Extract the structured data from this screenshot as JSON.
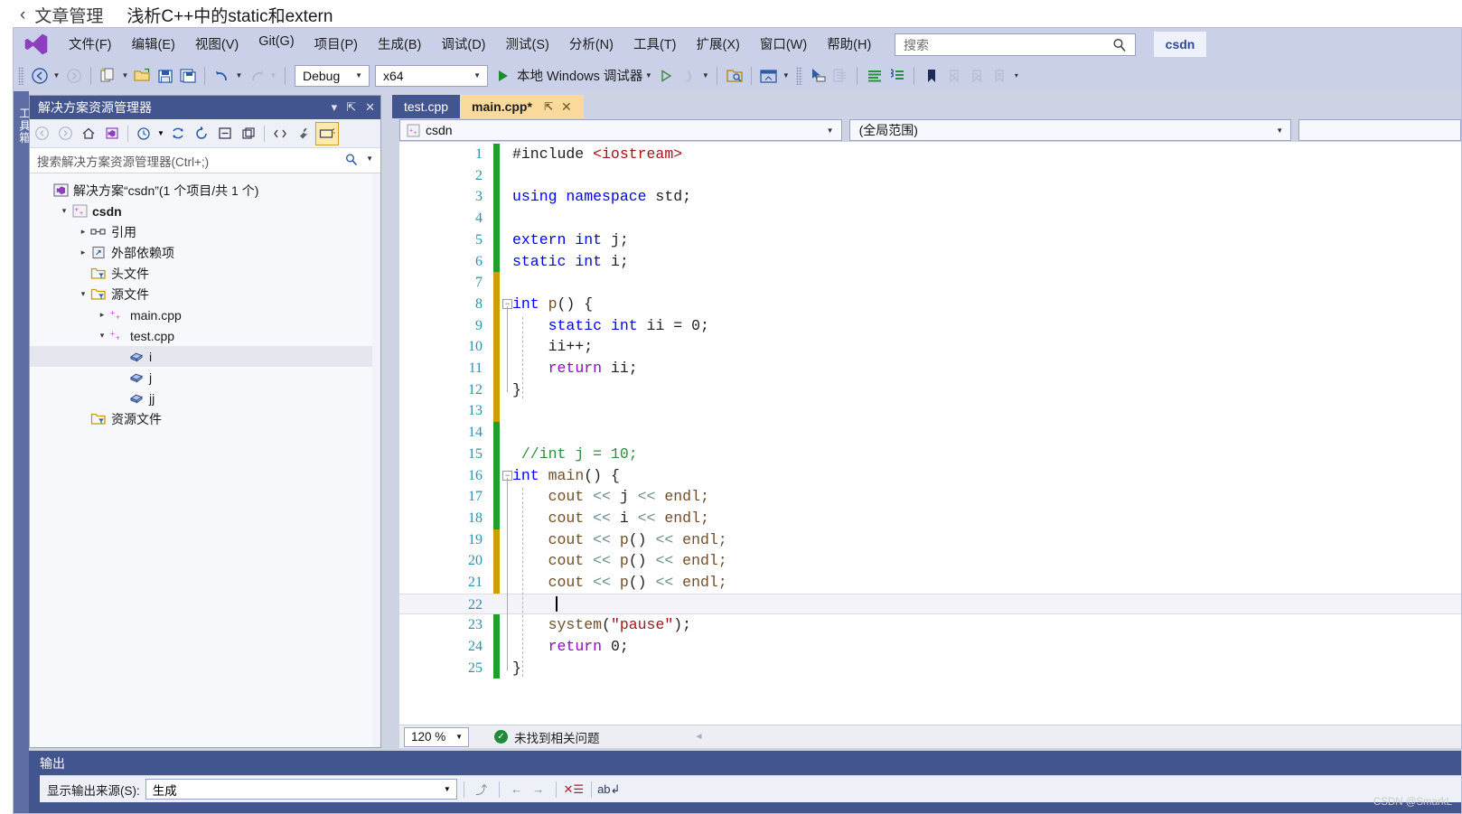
{
  "page_header": {
    "back_chevron": "‹",
    "breadcrumb": "文章管理",
    "article_title": "浅析C++中的static和extern"
  },
  "menubar": {
    "logo_icon": "visual-studio-logo",
    "items": [
      "文件(F)",
      "编辑(E)",
      "视图(V)",
      "Git(G)",
      "项目(P)",
      "生成(B)",
      "调试(D)",
      "测试(S)",
      "分析(N)",
      "工具(T)",
      "扩展(X)",
      "窗口(W)",
      "帮助(H)"
    ],
    "search_placeholder": "搜索",
    "search_icon": "search-icon",
    "account_chip": "csdn"
  },
  "toolbar": {
    "nav_back_icon": "navigate-back-icon",
    "nav_forward_icon": "navigate-forward-icon",
    "new_item_icon": "new-item-icon",
    "open_icon": "open-file-icon",
    "save_icon": "save-icon",
    "save_all_icon": "save-all-icon",
    "undo_icon": "undo-icon",
    "redo_icon": "redo-icon",
    "configuration": "Debug",
    "platform": "x64",
    "run_label": "本地 Windows 调试器",
    "run_icon": "play-icon",
    "attach_icon": "play-outline-icon",
    "hotreload_icon": "hot-reload-icon",
    "find_in_files_icon": "find-in-files-icon",
    "window_layout_icon": "window-layout-icon",
    "pointer_icon": "pointer-select-icon",
    "copy_lines_icon": "copy-lines-icon",
    "comment_icon": "comment-lines-icon",
    "uncomment_icon": "uncomment-lines-icon",
    "bookmark_icon": "bookmark-icon",
    "prev_bookmark_icon": "previous-bookmark-icon",
    "next_bookmark_icon": "next-bookmark-icon",
    "clear_bookmark_icon": "clear-bookmarks-icon",
    "overflow_icon": "toolbar-overflow-icon"
  },
  "toolbox_strip": {
    "label": "工具箱"
  },
  "solution_explorer": {
    "title": "解决方案资源管理器",
    "dropdown_icon": "chevron-down-icon",
    "pin_icon": "pin-icon",
    "close_icon": "close-icon",
    "toolbar_icons": [
      "back-icon",
      "forward-icon",
      "home-icon",
      "solution-view-icon",
      "pending-changes-icon",
      "refresh-icon",
      "sync-icon",
      "collapse-all-icon",
      "show-all-files-icon",
      "code-view-icon",
      "properties-icon",
      "preview-selected-items-icon"
    ],
    "search_placeholder": "搜索解决方案资源管理器(Ctrl+;)",
    "search_icon": "search-icon",
    "search_dropdown_icon": "chevron-down-icon",
    "tree": [
      {
        "label": "解决方案“csdn”(1 个项目/共 1 个)",
        "indent": 0,
        "arrow": "",
        "icon": "solution-icon",
        "bold": false,
        "selected": false
      },
      {
        "label": "csdn",
        "indent": 1,
        "arrow": "▾",
        "icon": "cpp-project-icon",
        "bold": true,
        "selected": false
      },
      {
        "label": "引用",
        "indent": 2,
        "arrow": "▸",
        "icon": "references-icon",
        "bold": false,
        "selected": false
      },
      {
        "label": "外部依赖项",
        "indent": 2,
        "arrow": "▸",
        "icon": "external-dependencies-icon",
        "bold": false,
        "selected": false
      },
      {
        "label": "头文件",
        "indent": 2,
        "arrow": "",
        "icon": "filter-folder-icon",
        "bold": false,
        "selected": false
      },
      {
        "label": "源文件",
        "indent": 2,
        "arrow": "▾",
        "icon": "filter-folder-icon",
        "bold": false,
        "selected": false
      },
      {
        "label": "main.cpp",
        "indent": 3,
        "arrow": "▸",
        "icon": "cpp-file-icon",
        "bold": false,
        "selected": false
      },
      {
        "label": "test.cpp",
        "indent": 3,
        "arrow": "▾",
        "icon": "cpp-file-icon",
        "bold": false,
        "selected": false
      },
      {
        "label": "i",
        "indent": 4,
        "arrow": "",
        "icon": "variable-icon",
        "bold": false,
        "selected": true
      },
      {
        "label": "j",
        "indent": 4,
        "arrow": "",
        "icon": "variable-icon",
        "bold": false,
        "selected": false
      },
      {
        "label": "jj",
        "indent": 4,
        "arrow": "",
        "icon": "variable-icon",
        "bold": false,
        "selected": false
      },
      {
        "label": "资源文件",
        "indent": 2,
        "arrow": "",
        "icon": "filter-folder-icon",
        "bold": false,
        "selected": false
      }
    ]
  },
  "editor": {
    "tabs": [
      {
        "label": "test.cpp",
        "active": false,
        "modified": false,
        "pin_icon": "",
        "close_icon": ""
      },
      {
        "label": "main.cpp*",
        "active": true,
        "modified": true,
        "pin_icon": "pin-icon",
        "close_icon": "close-icon"
      }
    ],
    "nav_project": "csdn",
    "nav_project_icon": "cpp-project-icon",
    "nav_scope": "(全局范围)",
    "nav_member": "",
    "dropdown_icon": "chevron-down-icon",
    "cursor_line": 22,
    "lines": [
      {
        "n": 1,
        "indent": 0,
        "fold": "",
        "change": "green",
        "tokens": [
          {
            "t": "#include ",
            "c": "pp"
          },
          {
            "t": "<iostream>",
            "c": "s"
          }
        ]
      },
      {
        "n": 2,
        "indent": 0,
        "fold": "",
        "change": "green",
        "tokens": []
      },
      {
        "n": 3,
        "indent": 0,
        "fold": "",
        "change": "green",
        "tokens": [
          {
            "t": "using namespace",
            "c": "k"
          },
          {
            "t": " std;",
            "c": "n"
          }
        ]
      },
      {
        "n": 4,
        "indent": 0,
        "fold": "",
        "change": "green",
        "tokens": []
      },
      {
        "n": 5,
        "indent": 0,
        "fold": "",
        "change": "green",
        "tokens": [
          {
            "t": "extern",
            "c": "k"
          },
          {
            "t": " ",
            "c": "n"
          },
          {
            "t": "int",
            "c": "k"
          },
          {
            "t": " j;",
            "c": "n"
          }
        ]
      },
      {
        "n": 6,
        "indent": 0,
        "fold": "",
        "change": "green",
        "tokens": [
          {
            "t": "static",
            "c": "k"
          },
          {
            "t": " ",
            "c": "n"
          },
          {
            "t": "int",
            "c": "k"
          },
          {
            "t": " i;",
            "c": "n"
          }
        ]
      },
      {
        "n": 7,
        "indent": 0,
        "fold": "",
        "change": "gold",
        "tokens": []
      },
      {
        "n": 8,
        "indent": 0,
        "fold": "minus",
        "change": "gold",
        "tokens": [
          {
            "t": "int",
            "c": "k"
          },
          {
            "t": " ",
            "c": "n"
          },
          {
            "t": "p",
            "c": "fn"
          },
          {
            "t": "() {",
            "c": "n"
          }
        ]
      },
      {
        "n": 9,
        "indent": 1,
        "fold": "",
        "change": "gold",
        "tokens": [
          {
            "t": "    ",
            "c": "n"
          },
          {
            "t": "static",
            "c": "k"
          },
          {
            "t": " ",
            "c": "n"
          },
          {
            "t": "int",
            "c": "k"
          },
          {
            "t": " ii = ",
            "c": "n"
          },
          {
            "t": "0",
            "c": "num"
          },
          {
            "t": ";",
            "c": "n"
          }
        ]
      },
      {
        "n": 10,
        "indent": 1,
        "fold": "",
        "change": "gold",
        "tokens": [
          {
            "t": "    ii++;",
            "c": "n"
          }
        ]
      },
      {
        "n": 11,
        "indent": 1,
        "fold": "",
        "change": "gold",
        "tokens": [
          {
            "t": "    ",
            "c": "n"
          },
          {
            "t": "return",
            "c": "ctl"
          },
          {
            "t": " ii;",
            "c": "n"
          }
        ]
      },
      {
        "n": 12,
        "indent": 1,
        "fold": "",
        "change": "gold",
        "tokens": [
          {
            "t": "}",
            "c": "n"
          }
        ]
      },
      {
        "n": 13,
        "indent": 0,
        "fold": "",
        "change": "gold",
        "tokens": []
      },
      {
        "n": 14,
        "indent": 0,
        "fold": "",
        "change": "green",
        "tokens": []
      },
      {
        "n": 15,
        "indent": 0,
        "fold": "",
        "change": "green",
        "tokens": [
          {
            "t": " //int j = 10;",
            "c": "cm"
          }
        ]
      },
      {
        "n": 16,
        "indent": 0,
        "fold": "minus",
        "change": "green",
        "tokens": [
          {
            "t": "int",
            "c": "k"
          },
          {
            "t": " ",
            "c": "n"
          },
          {
            "t": "main",
            "c": "fn"
          },
          {
            "t": "() {",
            "c": "n"
          }
        ]
      },
      {
        "n": 17,
        "indent": 1,
        "fold": "",
        "change": "green",
        "tokens": [
          {
            "t": "    cout ",
            "c": "fn"
          },
          {
            "t": "<<",
            "c": "op"
          },
          {
            "t": " j ",
            "c": "n"
          },
          {
            "t": "<<",
            "c": "op"
          },
          {
            "t": " endl;",
            "c": "fn"
          }
        ]
      },
      {
        "n": 18,
        "indent": 1,
        "fold": "",
        "change": "green",
        "tokens": [
          {
            "t": "    cout ",
            "c": "fn"
          },
          {
            "t": "<<",
            "c": "op"
          },
          {
            "t": " i ",
            "c": "n"
          },
          {
            "t": "<<",
            "c": "op"
          },
          {
            "t": " endl;",
            "c": "fn"
          }
        ]
      },
      {
        "n": 19,
        "indent": 1,
        "fold": "",
        "change": "gold",
        "tokens": [
          {
            "t": "    cout ",
            "c": "fn"
          },
          {
            "t": "<<",
            "c": "op"
          },
          {
            "t": " ",
            "c": "n"
          },
          {
            "t": "p",
            "c": "fn"
          },
          {
            "t": "() ",
            "c": "n"
          },
          {
            "t": "<<",
            "c": "op"
          },
          {
            "t": " endl;",
            "c": "fn"
          }
        ]
      },
      {
        "n": 20,
        "indent": 1,
        "fold": "",
        "change": "gold",
        "tokens": [
          {
            "t": "    cout ",
            "c": "fn"
          },
          {
            "t": "<<",
            "c": "op"
          },
          {
            "t": " ",
            "c": "n"
          },
          {
            "t": "p",
            "c": "fn"
          },
          {
            "t": "() ",
            "c": "n"
          },
          {
            "t": "<<",
            "c": "op"
          },
          {
            "t": " endl;",
            "c": "fn"
          }
        ]
      },
      {
        "n": 21,
        "indent": 1,
        "fold": "",
        "change": "gold",
        "tokens": [
          {
            "t": "    cout ",
            "c": "fn"
          },
          {
            "t": "<<",
            "c": "op"
          },
          {
            "t": " ",
            "c": "n"
          },
          {
            "t": "p",
            "c": "fn"
          },
          {
            "t": "() ",
            "c": "n"
          },
          {
            "t": "<<",
            "c": "op"
          },
          {
            "t": " endl;",
            "c": "fn"
          }
        ]
      },
      {
        "n": 22,
        "indent": 1,
        "fold": "",
        "change": "gold",
        "tokens": []
      },
      {
        "n": 23,
        "indent": 1,
        "fold": "",
        "change": "green",
        "tokens": [
          {
            "t": "    ",
            "c": "n"
          },
          {
            "t": "system",
            "c": "fn"
          },
          {
            "t": "(",
            "c": "n"
          },
          {
            "t": "\"pause\"",
            "c": "s"
          },
          {
            "t": ");",
            "c": "n"
          }
        ]
      },
      {
        "n": 24,
        "indent": 1,
        "fold": "",
        "change": "green",
        "tokens": [
          {
            "t": "    ",
            "c": "n"
          },
          {
            "t": "return",
            "c": "ctl"
          },
          {
            "t": " ",
            "c": "n"
          },
          {
            "t": "0",
            "c": "num"
          },
          {
            "t": ";",
            "c": "n"
          }
        ]
      },
      {
        "n": 25,
        "indent": 1,
        "fold": "",
        "change": "green",
        "tokens": [
          {
            "t": "}",
            "c": "n"
          }
        ]
      }
    ]
  },
  "editor_status": {
    "zoom": "120 %",
    "zoom_dropdown_icon": "chevron-down-icon",
    "status_icon": "success-check-icon",
    "status_text": "未找到相关问题",
    "scroll_left_icon": "scroll-left-icon"
  },
  "output_pane": {
    "title": "输出",
    "source_label": "显示输出来源(S):",
    "source_value": "生成",
    "dropdown_icon": "chevron-down-icon",
    "icons": [
      "jump-icon",
      "back-arrow-icon",
      "forward-arrow-icon",
      "clear-all-icon",
      "word-wrap-icon"
    ]
  },
  "watermark": "CSDN @SmarkL",
  "colors": {
    "vs_chrome": "#c9d0e8",
    "panel_header": "#43558e",
    "active_tab": "#fbd89b",
    "change_saved": "#1f9d2f",
    "change_unsaved": "#c9a000",
    "keyword": "#0000ff",
    "string": "#a31515",
    "comment": "#2f8f3e",
    "linenum": "#2b91af"
  }
}
